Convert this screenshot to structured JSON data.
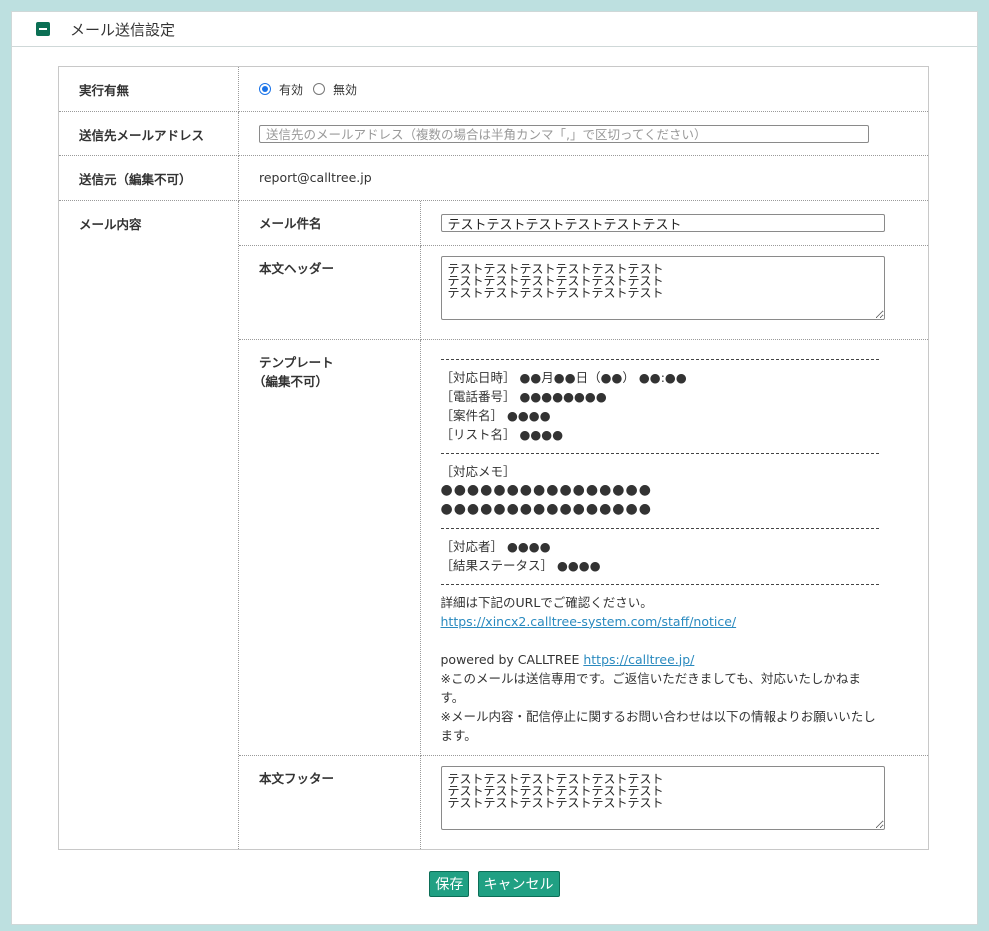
{
  "panel": {
    "title": "メール送信設定"
  },
  "enable": {
    "label": "実行有無",
    "options": [
      "有効",
      "無効"
    ],
    "selected": "有効"
  },
  "to": {
    "label": "送信先メールアドレス",
    "placeholder": "送信先のメールアドレス（複数の場合は半角カンマ「,」で区切ってください）",
    "value": ""
  },
  "from": {
    "label": "送信元（編集不可）",
    "value": "report@calltree.jp"
  },
  "mail": {
    "label": "メール内容",
    "subject": {
      "label": "メール件名",
      "value": "テストテストテストテストテストテスト"
    },
    "header": {
      "label": "本文ヘッダー",
      "value": "テストテストテストテストテストテスト\nテストテストテストテストテストテスト\nテストテストテストテストテストテスト"
    },
    "template": {
      "label_line1": "テンプレート",
      "label_line2": "（編集不可）",
      "section1": [
        "［対応日時］ ●●月●●日（●●） ●●:●●",
        "［電話番号］ ●●●●●●●●",
        "［案件名］ ●●●●",
        "［リスト名］ ●●●●"
      ],
      "memo_label": "［対応メモ］",
      "memo_lines": [
        "●●●●●●●●●●●●●●●●",
        "●●●●●●●●●●●●●●●●"
      ],
      "section3": [
        "［対応者］ ●●●●",
        "［結果ステータス］ ●●●●"
      ],
      "details_text": "詳細は下記のURLでご確認ください。",
      "details_url": "https://xincx2.calltree-system.com/staff/notice/",
      "powered_by": "powered by CALLTREE ",
      "powered_url": "https://calltree.jp/",
      "note1_line1": "※このメールは送信専用です。ご返信いただきましても、対応いたしかねま",
      "note1_line2": "す。",
      "note2_line1": "※メール内容・配信停止に関するお問い合わせは以下の情報よりお願いいたし",
      "note2_line2": "ます。"
    },
    "footer": {
      "label": "本文フッター",
      "value": "テストテストテストテストテストテスト\nテストテストテストテストテストテスト\nテストテストテストテストテストテスト"
    }
  },
  "buttons": {
    "save": "保存",
    "cancel": "キャンセル"
  },
  "colors": {
    "accent": "#20a083",
    "header_icon": "#0b6f54",
    "link": "#2a8abf",
    "background": "#bde0e0"
  }
}
